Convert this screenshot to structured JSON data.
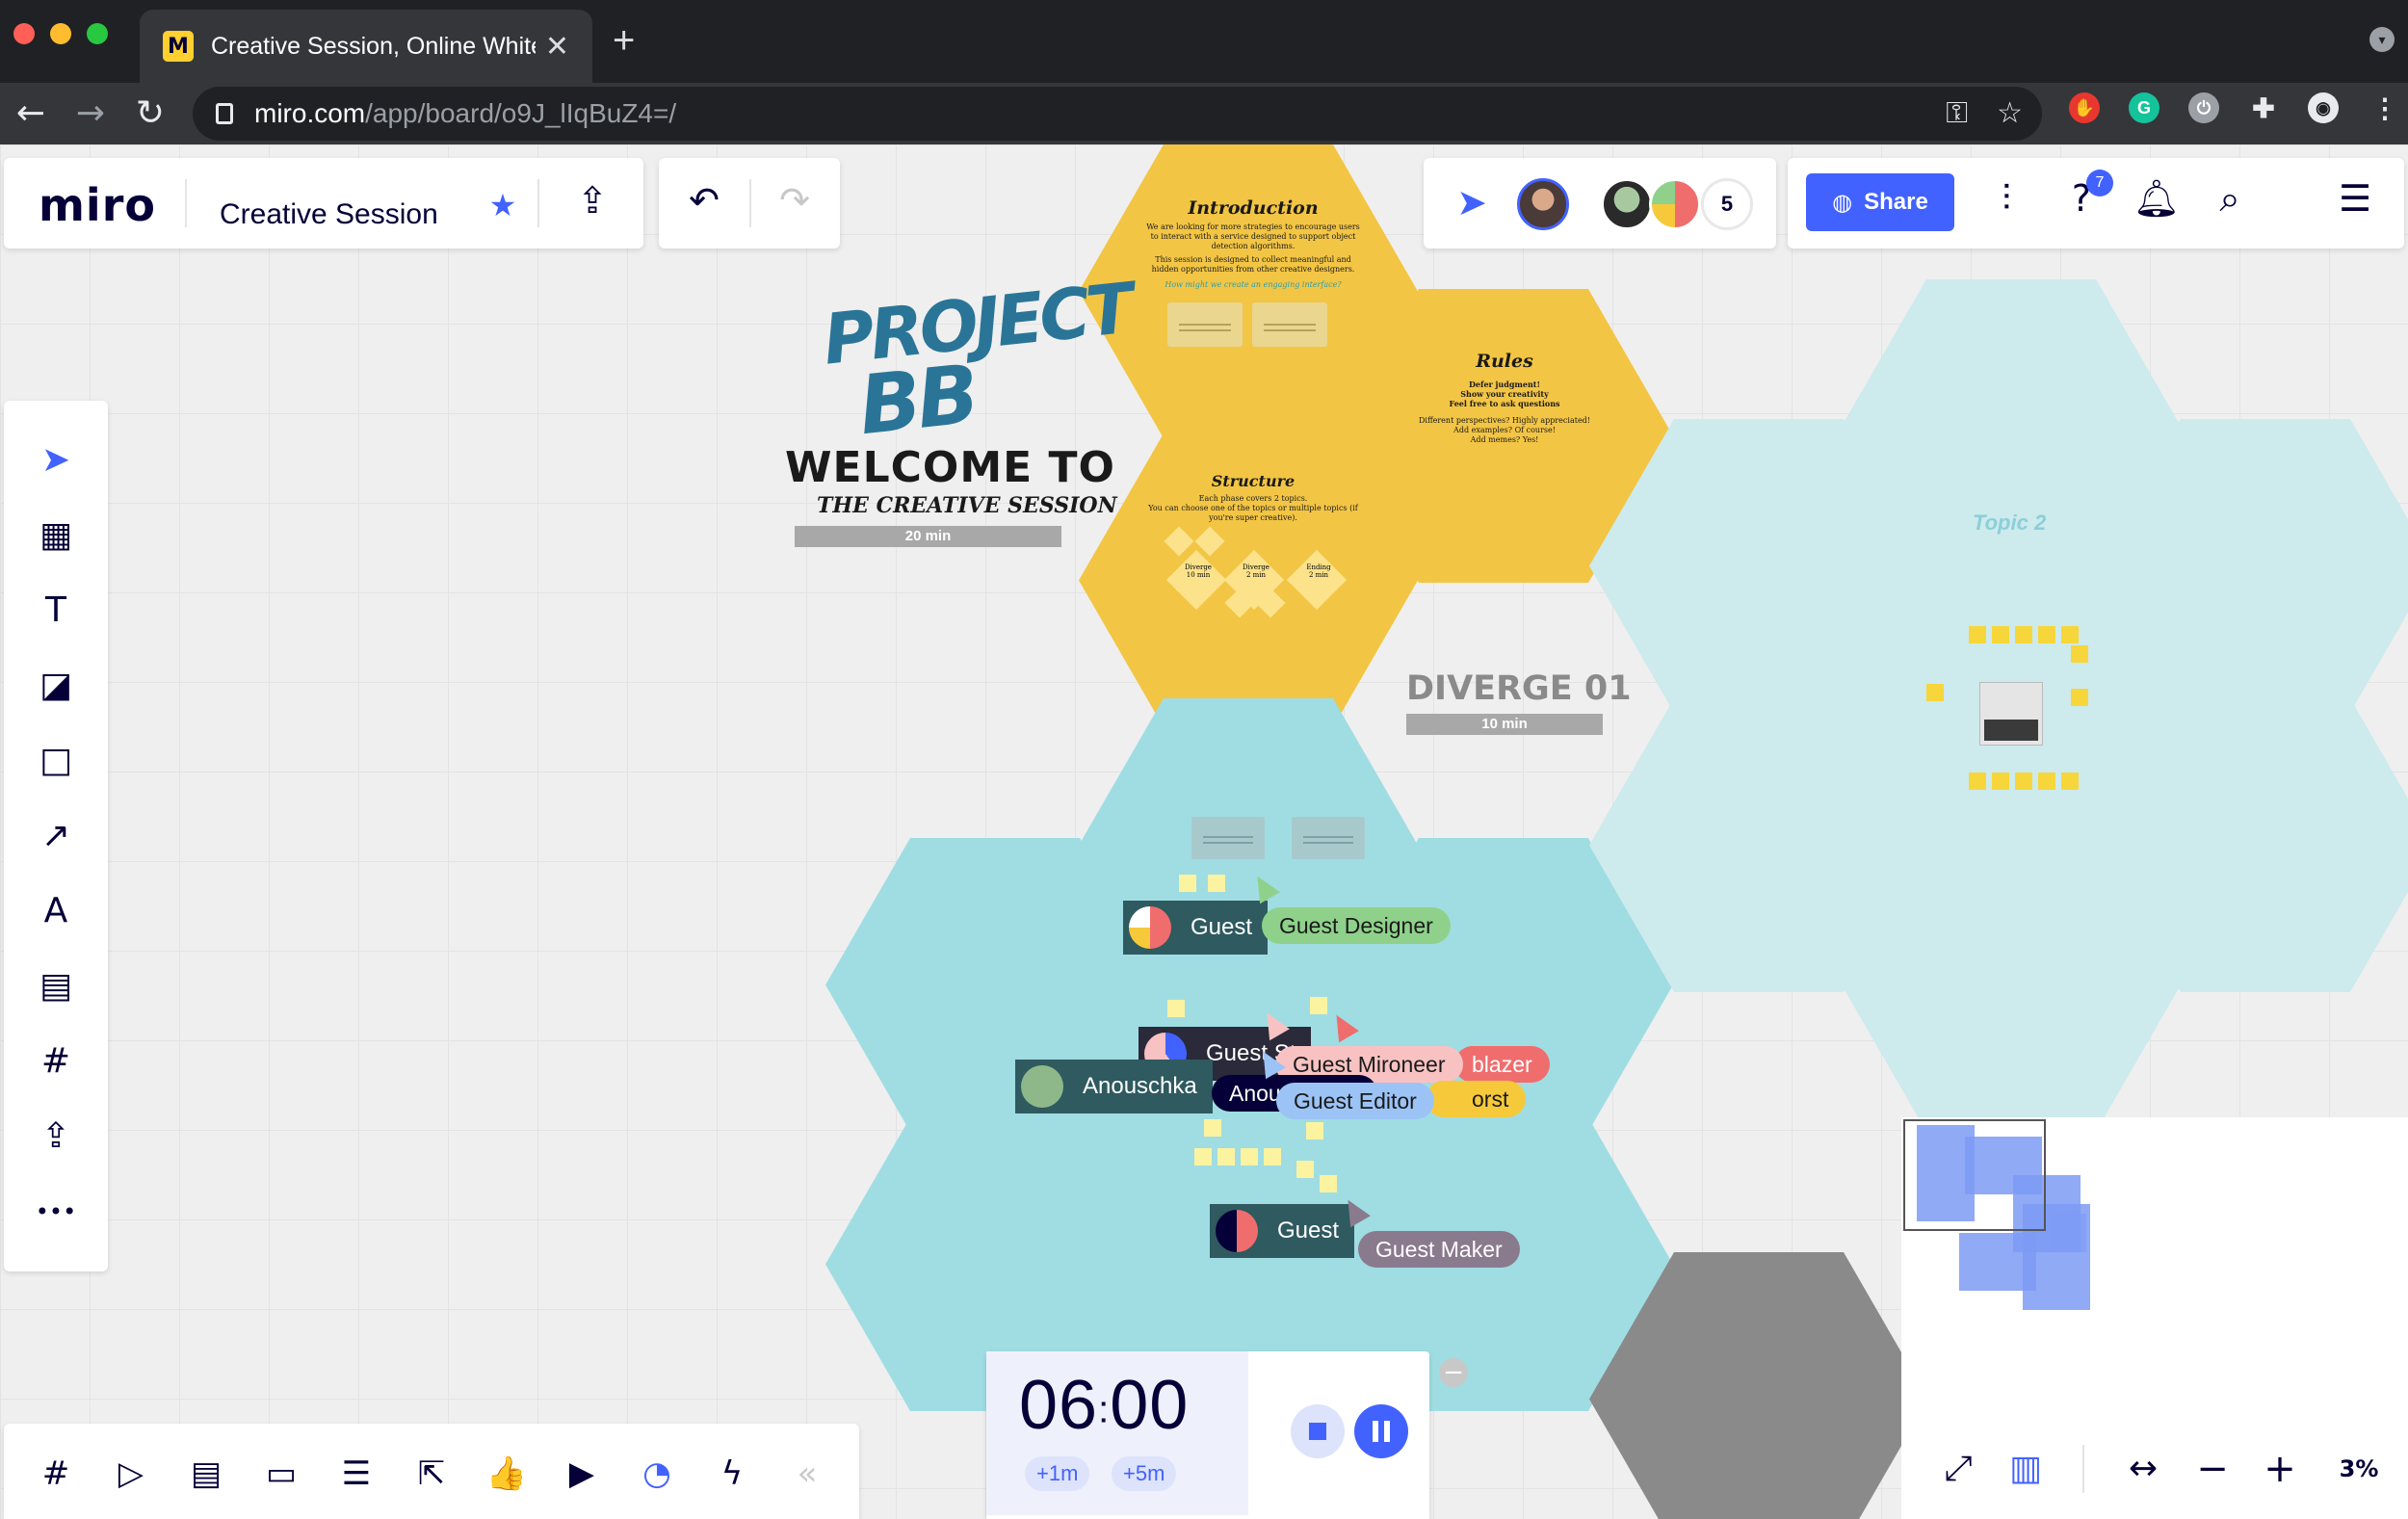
{
  "browser": {
    "tab_title": "Creative Session, Online White",
    "tab_close": "✕",
    "new_tab": "+",
    "url_host": "miro.com",
    "url_path": "/app/board/o9J_lIqBuZ4=/",
    "nav_back": "←",
    "nav_forward": "→",
    "nav_reload": "↻",
    "tab_dropdown": "▾",
    "ext_grammarly": "G"
  },
  "header": {
    "brand": "miro",
    "board_title": "Creative Session",
    "star": "★",
    "share_label": "Share",
    "user_count": "5",
    "help_badge": "7"
  },
  "board": {
    "intro_title": "Introduction",
    "intro_text": "We are looking for more strategies to encourage users to interact with a service designed to support object detection algorithms.",
    "intro_text2": "This session is designed to collect meaningful and hidden opportunities from other creative designers.",
    "intro_question": "How might we create an engaging interface?",
    "rules_title": "Rules",
    "rules_lines": [
      "Defer judgment!",
      "Show your creativity",
      "Feel free to ask questions",
      "Different perspectives? Highly appreciated!",
      "Add examples? Of course!",
      "Add memes? Yes!"
    ],
    "structure_title": "Structure",
    "structure_text": "Each phase covers 2 topics.",
    "structure_text2": "You can choose one of the topics or multiple topics (if you're super creative).",
    "structure_nodes": [
      "Diverge",
      "Diverge",
      "Ending"
    ],
    "structure_times": [
      "10 min",
      "2 min",
      "2 min"
    ],
    "project_logo_line1": "PROJECT",
    "project_logo_line2": "BB",
    "welcome": "WELCOME TO",
    "creative": "THE CREATIVE SESSION",
    "welcome_time": "20 min",
    "diverge_title": "DIVERGE 01",
    "diverge_time": "10 min",
    "topic2": "Topic 2"
  },
  "cursors": {
    "guest1": "Guest",
    "guest_designer": "Guest Designer",
    "guest_st": "Guest St",
    "guest_mironeer": "Guest Mironeer",
    "blazer": "blazer",
    "anouschka": "Anouschka",
    "anou": "Anou",
    "guest_editor": "Guest Editor",
    "orst": "orst",
    "guest2": "Guest",
    "guest_maker": "Guest Maker"
  },
  "toolbar": {
    "select": "➤",
    "templates": "▦",
    "text": "T",
    "sticky": "◪",
    "shape": "□",
    "arrow": "↗",
    "pen": "A",
    "comment": "▤",
    "frame": "#",
    "upload": "⇪",
    "more": "•••"
  },
  "bottom_toolbar": [
    "#",
    "▷",
    "▤",
    "▭",
    "☰",
    "⇱",
    "👍",
    "▶",
    "◔",
    "ϟ",
    "«"
  ],
  "timer": {
    "minutes": "06",
    "seconds": "00",
    "add1": "+1m",
    "add5": "+5m",
    "collapse": "−"
  },
  "minimap": {
    "expand": "⤢",
    "map": "▥",
    "fit": "↔",
    "zoom_out": "−",
    "zoom_in": "+",
    "zoom_level": "3%"
  },
  "colors": {
    "accent": "#4262ff",
    "hex_yellow": "#f3c544",
    "hex_teal": "#9fdde3",
    "guest_designer": "#8fd18b",
    "guest_mironeer": "#f8c2c2",
    "guest_editor": "#9cc3f5",
    "guest_maker": "#8a7a8e",
    "blazer": "#f06d6d",
    "orst": "#f6c93b"
  }
}
